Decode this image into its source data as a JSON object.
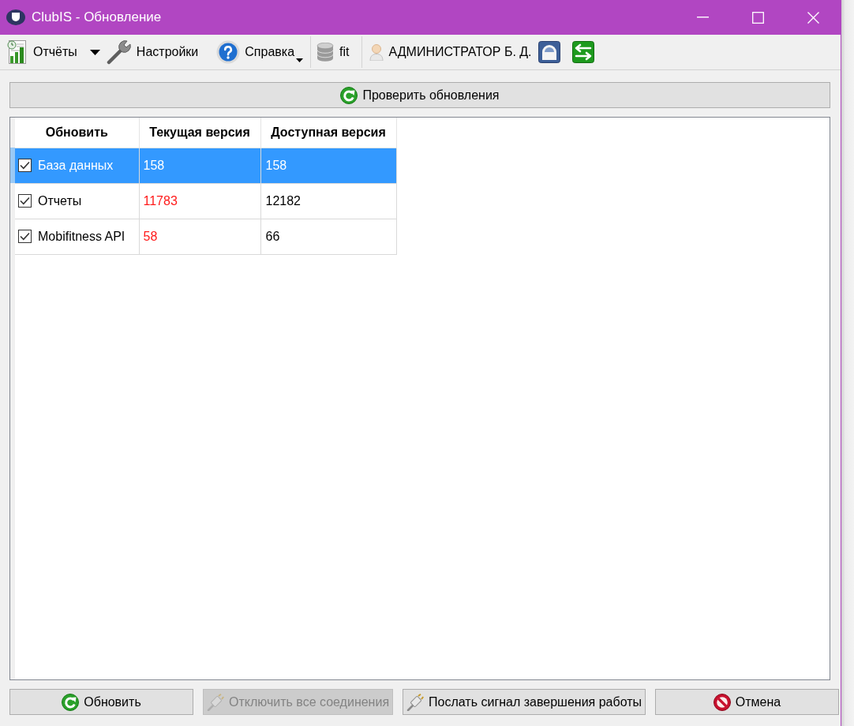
{
  "window": {
    "title": "ClubIS - Обновление"
  },
  "toolbar": [
    {
      "items": [
        {
          "kind": "split",
          "label": "Отчёты"
        },
        {
          "kind": "button",
          "label": "Настройки"
        },
        {
          "kind": "menu",
          "label": "Справка"
        }
      ]
    },
    {
      "items": [
        {
          "kind": "label",
          "label": "fit"
        }
      ]
    },
    {
      "items": [
        {
          "kind": "label",
          "label": "АДМИНИСТРАТОР Б. Д."
        },
        {
          "kind": "icon"
        },
        {
          "kind": "icon"
        }
      ]
    }
  ],
  "check_button": {
    "label": "Проверить обновления"
  },
  "table": {
    "columns": [
      "Обновить",
      "Текущая версия",
      "Доступная версия"
    ],
    "rows": [
      {
        "name": "База данных",
        "checked": true,
        "selected": true,
        "current": "158",
        "outdated": false,
        "available": "158"
      },
      {
        "name": "Отчеты",
        "checked": true,
        "selected": false,
        "current": "11783",
        "outdated": true,
        "available": "12182"
      },
      {
        "name": "Mobifitness API",
        "checked": true,
        "selected": false,
        "current": "58",
        "outdated": true,
        "available": "66"
      }
    ]
  },
  "buttons": [
    {
      "label": "Обновить",
      "disabled": false
    },
    {
      "label": "Отключить все соединения",
      "disabled": true
    },
    {
      "label": "Послать сигнал завершения работы",
      "disabled": false
    },
    {
      "label": "Отмена",
      "disabled": false
    }
  ]
}
